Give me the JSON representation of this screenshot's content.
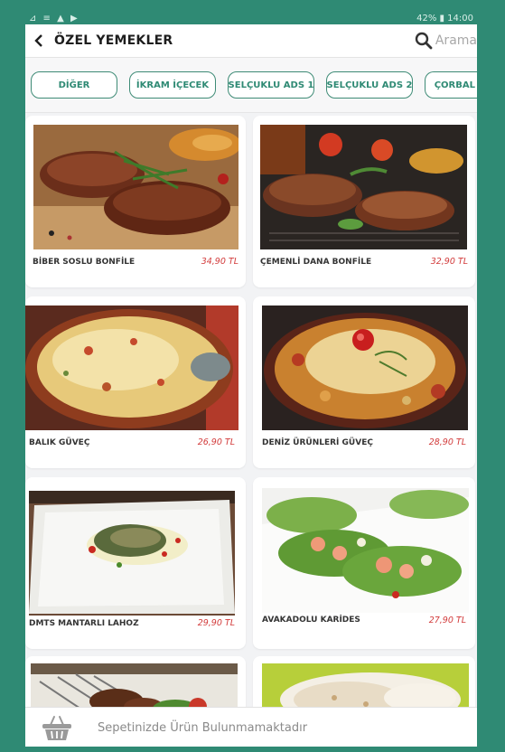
{
  "statusbar": {
    "left_icons": "⊿ ≡ ▲ ▶",
    "right": "42% ▮ 14:00"
  },
  "header": {
    "title": "ÖZEL YEMEKLER",
    "search_placeholder": "Arama"
  },
  "tabs": [
    {
      "label": "DİĞER"
    },
    {
      "label": "İKRAM İÇECEK"
    },
    {
      "label": "SELÇUKLU ADS 1"
    },
    {
      "label": "SELÇUKLU ADS 2"
    },
    {
      "label": "ÇORBAL"
    }
  ],
  "products": [
    {
      "name": "BİBER SOSLU BONFİLE",
      "price": "34,90 TL",
      "image": "steak-platter"
    },
    {
      "name": "ÇEMENLİ DANA BONFİLE",
      "price": "32,90 TL",
      "image": "steak-dark"
    },
    {
      "name": "BALIK GÜVEÇ",
      "price": "26,90 TL",
      "image": "fish-casserole"
    },
    {
      "name": "DENİZ ÜRÜNLERİ GÜVEÇ",
      "price": "28,90 TL",
      "image": "seafood-casserole"
    },
    {
      "name": "DMTS MANTARLI LAHOZ",
      "price": "29,90 TL",
      "image": "fish-plate"
    },
    {
      "name": "AVAKADOLU KARİDES",
      "price": "27,90 TL",
      "image": "shrimp-lettuce"
    },
    {
      "name": "",
      "price": "",
      "image": "kebab-skewers"
    },
    {
      "name": "",
      "price": "",
      "image": "wraps"
    }
  ],
  "cart": {
    "message": "Sepetinizde Ürün Bulunmamaktadır"
  },
  "colors": {
    "frame": "#2f8a74",
    "accent": "#2f8a74",
    "price": "#d23a3a"
  }
}
